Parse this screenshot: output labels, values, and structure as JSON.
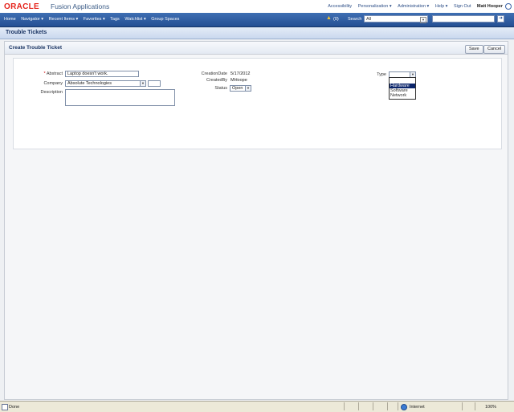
{
  "brand": {
    "logo": "ORACLE",
    "app_name": "Fusion Applications",
    "links": [
      "Accessibility",
      "Personalization ▾",
      "Administration ▾",
      "Help ▾",
      "Sign Out"
    ],
    "user": "Matt Hooper"
  },
  "nav": {
    "items": [
      "Home",
      "Navigator ▾",
      "Recent Items ▾",
      "Favorites ▾",
      "Tags",
      "Watchlist ▾",
      "Group Spaces"
    ],
    "notification_count": "(0)",
    "search_label": "Search",
    "search_scope": "All",
    "search_value": ""
  },
  "page": {
    "title": "Trouble Tickets"
  },
  "panel": {
    "title": "Create Trouble Ticket",
    "save_label": "Save",
    "cancel_label": "Cancel"
  },
  "form": {
    "required_marker": "*",
    "abstract_label": "Abstract",
    "abstract_value": "Laptop doesn't work.",
    "company_label": "Company",
    "company_value": "Absolute Technologies",
    "description_label": "Description",
    "description_value": "",
    "creation_date_label": "CreationDate",
    "creation_date_value": "5/17/2012",
    "created_by_label": "CreatedBy",
    "created_by_value": "MHoope",
    "status_label": "Status",
    "status_value": "Open",
    "type_label": "Type",
    "type_value": "",
    "type_options": [
      "Hardware",
      "Software",
      "Network"
    ],
    "type_highlighted": "Hardware"
  },
  "statusbar": {
    "status_text": "Done",
    "zone": "Internet",
    "zoom": "100%"
  }
}
